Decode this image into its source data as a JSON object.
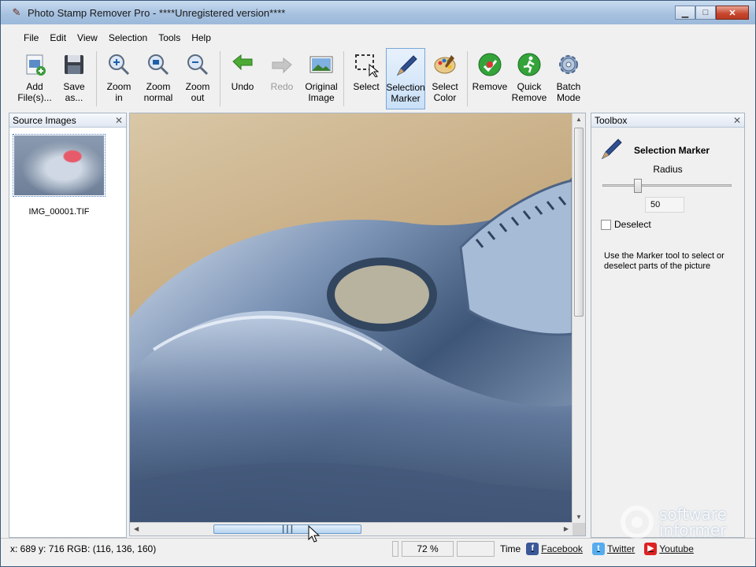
{
  "window": {
    "title": "Photo Stamp Remover Pro - ****Unregistered version****"
  },
  "menu": [
    "File",
    "Edit",
    "View",
    "Selection",
    "Tools",
    "Help"
  ],
  "toolbar": {
    "add": "Add\nFile(s)...",
    "save": "Save\nas...",
    "zoom_in": "Zoom\nin",
    "zoom_normal": "Zoom\nnormal",
    "zoom_out": "Zoom\nout",
    "undo": "Undo",
    "redo": "Redo",
    "original": "Original\nImage",
    "select": "Select",
    "selection_marker": "Selection\nMarker",
    "select_color": "Select\nColor",
    "remove": "Remove",
    "quick_remove": "Quick\nRemove",
    "batch_mode": "Batch\nMode"
  },
  "source_panel": {
    "title": "Source Images",
    "file": "IMG_00001.TIF"
  },
  "toolbox": {
    "title": "Toolbox",
    "tool_name": "Selection Marker",
    "radius_label": "Radius",
    "radius_value": "50",
    "radius_level": 0.25,
    "deselect_label": "Deselect",
    "help": "Use the Marker tool to select or deselect parts of the picture"
  },
  "status": {
    "coords": "x: 689 y: 716  RGB: (116, 136, 160)",
    "zoom": "72 %",
    "time_label": "Time",
    "facebook": "Facebook",
    "twitter": "Twitter",
    "youtube": "Youtube"
  },
  "watermark": {
    "line1": "software",
    "line2": "informer"
  },
  "colors": {
    "active_tool": "#c9e0f7",
    "titlebar": "#a7c2e0"
  }
}
